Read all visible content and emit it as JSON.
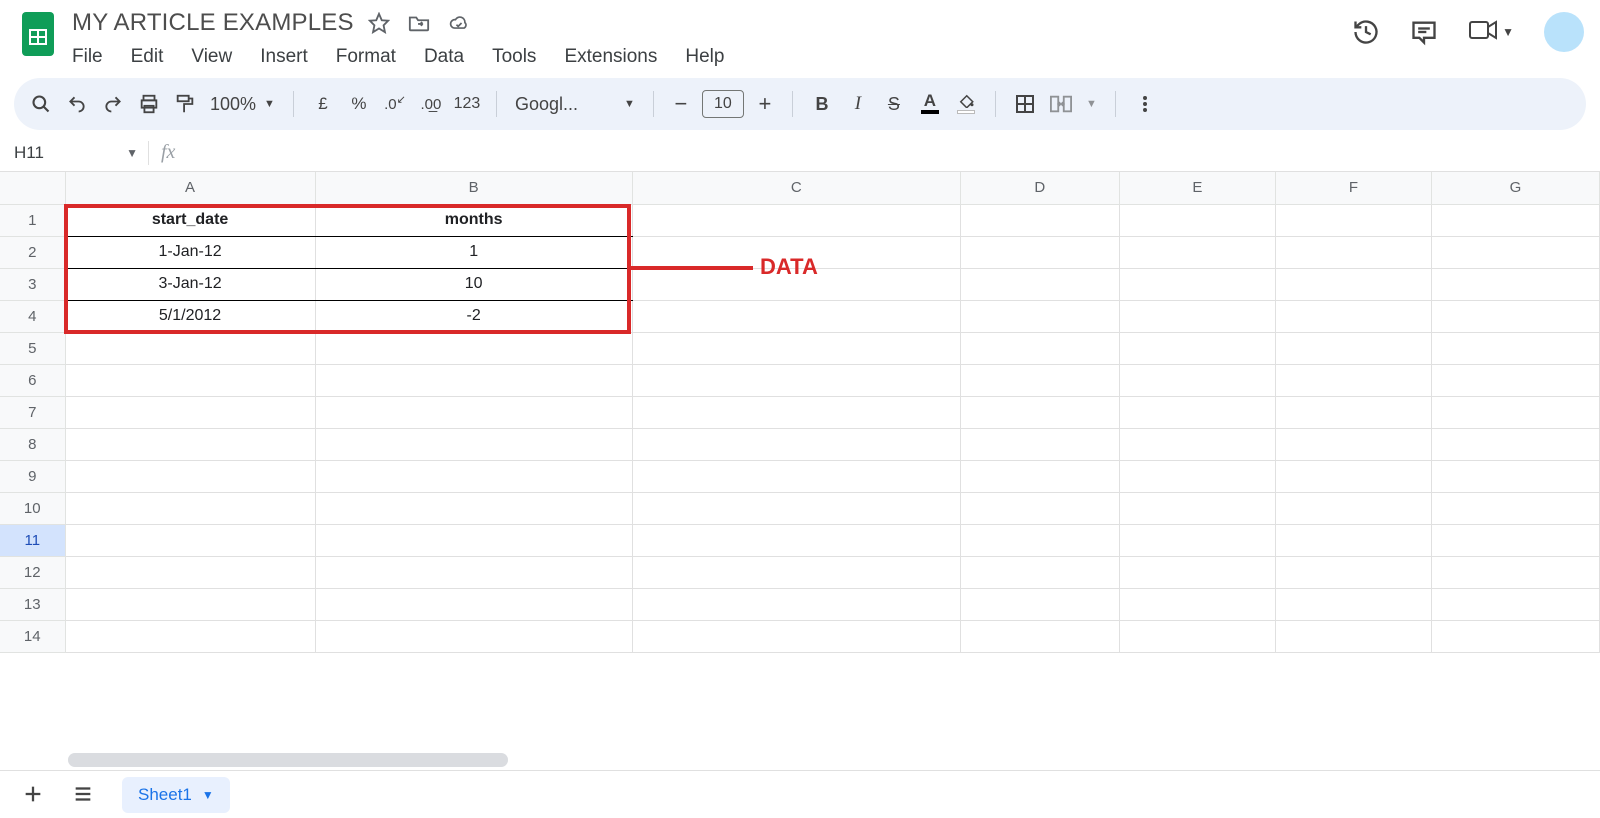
{
  "header": {
    "doc_title": "MY ARTICLE EXAMPLES",
    "menus": [
      "File",
      "Edit",
      "View",
      "Insert",
      "Format",
      "Data",
      "Tools",
      "Extensions",
      "Help"
    ]
  },
  "toolbar": {
    "zoom": "100%",
    "currency_symbol": "£",
    "percent_symbol": "%",
    "dec_decrease": ".0",
    "dec_increase": ".00",
    "numfmt": "123",
    "font_name": "Googl...",
    "font_size": "10"
  },
  "formula_bar": {
    "name_box": "H11",
    "fx_label": "fx",
    "formula": ""
  },
  "grid": {
    "columns": [
      "A",
      "B",
      "C",
      "D",
      "E",
      "F",
      "G"
    ],
    "row_count": 14,
    "selected_row": 11,
    "data": {
      "A1": "start_date",
      "B1": "months",
      "A2": "1-Jan-12",
      "B2": "1",
      "A3": "3-Jan-12",
      "B3": "10",
      "A4": "5/1/2012",
      "B4": "-2"
    }
  },
  "annotation": {
    "label": "DATA"
  },
  "tabs": {
    "active": "Sheet1"
  }
}
